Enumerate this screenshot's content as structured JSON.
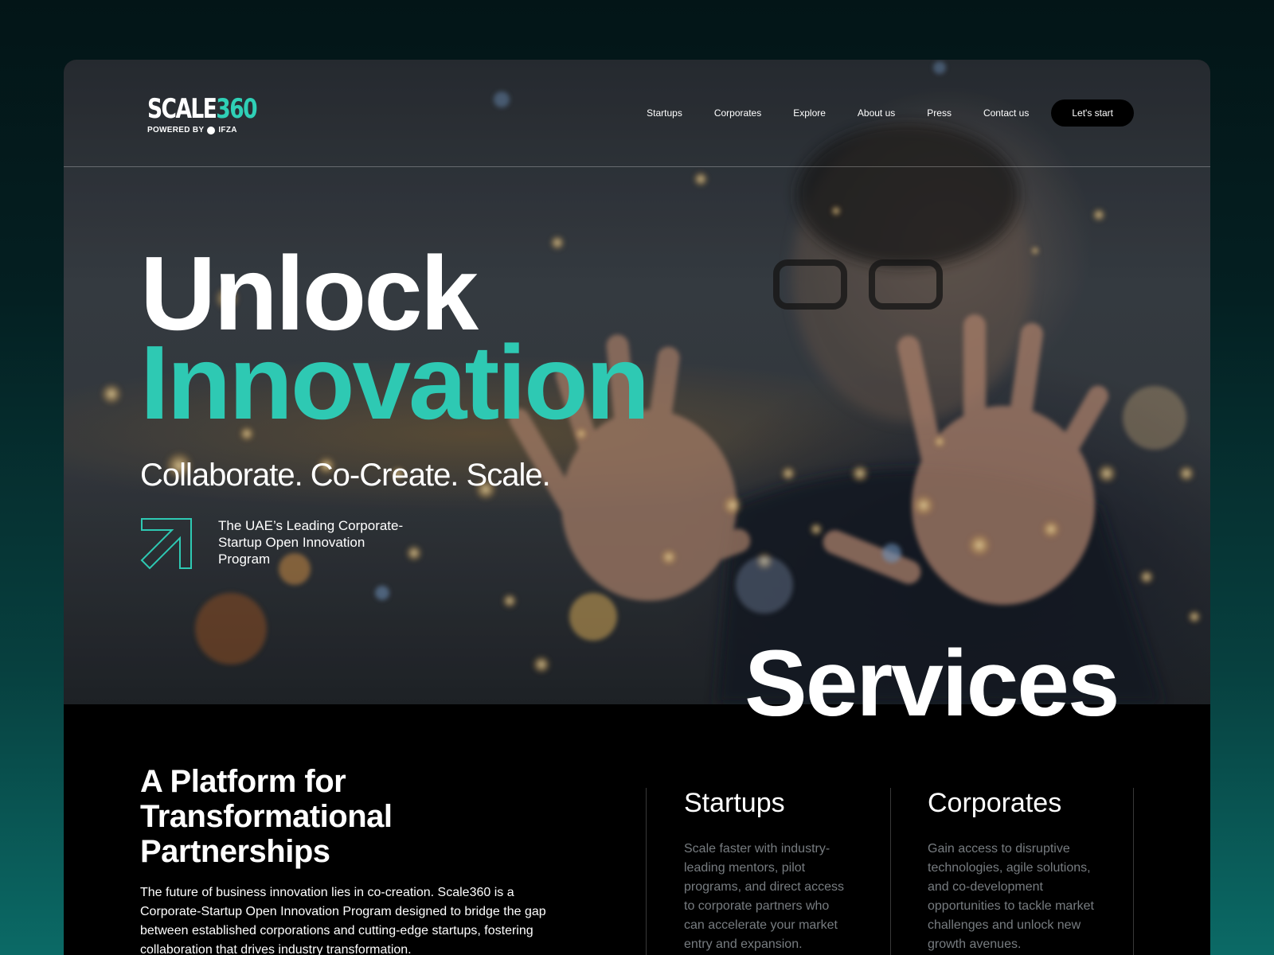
{
  "brand": {
    "logo_main": "SCALE",
    "logo_number": "360",
    "logo_sub_prefix": "POWERED BY",
    "logo_sub_partner": "IFZA"
  },
  "nav": {
    "links": [
      "Startups",
      "Corporates",
      "Explore",
      "About us",
      "Press",
      "Contact us"
    ],
    "cta": "Let's start"
  },
  "hero": {
    "headline_line1": "Unlock",
    "headline_line2": "Innovation",
    "tagline": "Collaborate. Co-Create. Scale.",
    "program_text": "The UAE’s Leading Corporate-Startup Open Innovation Program"
  },
  "services": {
    "section_title": "Services",
    "platform_title": "A Platform for Transformational Partnerships",
    "platform_body": "The future of business innovation lies in co-creation. Scale360 is a Corporate-Startup Open Innovation Program designed to bridge the gap between established corporations and cutting-edge startups, fostering collaboration that drives industry transformation.",
    "items": [
      {
        "title": "Startups",
        "description": "Scale faster with industry-leading mentors, pilot programs, and direct access to corporate partners who can accelerate your market entry and expansion."
      },
      {
        "title": "Corporates",
        "description": "Gain access to disruptive technologies, agile solutions, and co-development opportunities to tackle market challenges and unlock new growth avenues."
      }
    ]
  },
  "colors": {
    "accent": "#2ec9b3",
    "background_dark": "#000000",
    "page_gradient_top": "#031517",
    "page_gradient_bottom": "#0b6a66",
    "muted_text": "#777c80"
  },
  "icons": {
    "program_arrow": "arrow-up-right-icon",
    "partner_logo": "ifza-logo-icon"
  }
}
